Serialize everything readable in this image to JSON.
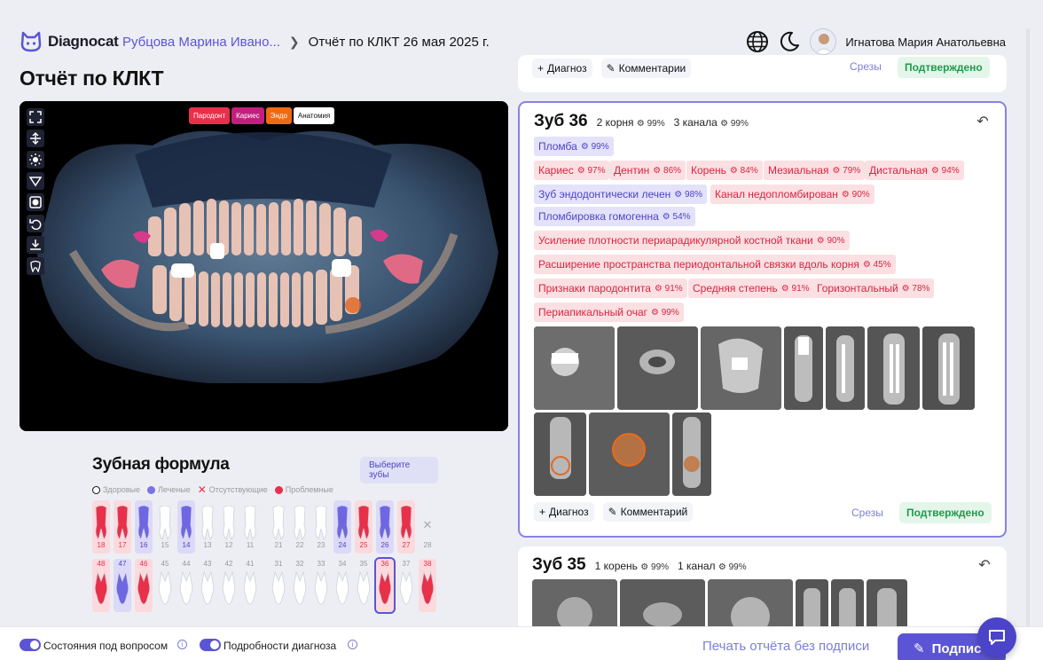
{
  "app": {
    "name": "Diagnocat"
  },
  "breadcrumb": {
    "patient": "Рубцова Марина Ивано...",
    "report": "Отчёт по КЛКТ 26 мая 2025 г."
  },
  "user": {
    "name": "Игнатова Мария Анатольевна"
  },
  "page": {
    "title": "Отчёт по КЛКТ"
  },
  "viewer": {
    "tabs": [
      "Пародонт",
      "Кариес",
      "Эндо",
      "Анатомия"
    ]
  },
  "top_card": {
    "diagnosis_label": "Диагноз",
    "comment_label": "Комментарии",
    "slices_label": "Срезы",
    "status": "Подтверждено"
  },
  "tooth36": {
    "title": "Зуб 36",
    "roots": "2 корня",
    "roots_pct": "99%",
    "canals": "3 канала",
    "canals_pct": "99%",
    "tags": [
      {
        "label": "Пломба",
        "pct": "99%"
      },
      {
        "label": "Кариес",
        "pct": "97%"
      },
      {
        "label": "Дентин",
        "pct": "86%"
      },
      {
        "label": "Корень",
        "pct": "84%"
      },
      {
        "label": "Мезиальная",
        "pct": "79%"
      },
      {
        "label": "Дистальная",
        "pct": "94%"
      },
      {
        "label": "Зуб эндодонтически лечен",
        "pct": "98%"
      },
      {
        "label": "Канал недопломбирован",
        "pct": "90%"
      },
      {
        "label": "Пломбировка гомогенна",
        "pct": "54%"
      },
      {
        "label": "Усиление плотности периарадикулярной костной ткани",
        "pct": "90%"
      },
      {
        "label": "Расширение пространства периодонтальной связки вдоль корня",
        "pct": "45%"
      },
      {
        "label": "Признаки пародонтита",
        "pct": "91%"
      },
      {
        "label": "Средняя степень",
        "pct": "91%"
      },
      {
        "label": "Горизонтальный",
        "pct": "78%"
      },
      {
        "label": "Периапикальный очаг",
        "pct": "99%"
      }
    ],
    "diagnosis_label": "Диагноз",
    "comment_label": "Комментарий",
    "slices_label": "Срезы",
    "status": "Подтверждено"
  },
  "tooth35": {
    "title": "Зуб 35",
    "roots": "1 корень",
    "roots_pct": "99%",
    "canals": "1 канал",
    "canals_pct": "99%"
  },
  "formula": {
    "title": "Зубная формула",
    "select_button": "Выберите зубы",
    "legend": [
      {
        "label": "Здоровые",
        "color": "#ffffff"
      },
      {
        "label": "Леченые",
        "color": "#7b72e8"
      },
      {
        "label": "Отсутствующие",
        "color": "#e8304a"
      },
      {
        "label": "Проблемные",
        "color": "#e8304a"
      }
    ],
    "upper": [
      {
        "n": "18",
        "s": "problem"
      },
      {
        "n": "17",
        "s": "problem"
      },
      {
        "n": "16",
        "s": "treated"
      },
      {
        "n": "15",
        "s": "healthy"
      },
      {
        "n": "14",
        "s": "treated"
      },
      {
        "n": "13",
        "s": "healthy"
      },
      {
        "n": "12",
        "s": "healthy"
      },
      {
        "n": "11",
        "s": "healthy"
      },
      {
        "n": "21",
        "s": "healthy"
      },
      {
        "n": "22",
        "s": "healthy"
      },
      {
        "n": "23",
        "s": "healthy"
      },
      {
        "n": "24",
        "s": "treated"
      },
      {
        "n": "25",
        "s": "problem"
      },
      {
        "n": "26",
        "s": "treated"
      },
      {
        "n": "27",
        "s": "problem"
      },
      {
        "n": "28",
        "s": "missing"
      }
    ],
    "lower": [
      {
        "n": "48",
        "s": "problem"
      },
      {
        "n": "47",
        "s": "treated"
      },
      {
        "n": "46",
        "s": "problem"
      },
      {
        "n": "45",
        "s": "healthy"
      },
      {
        "n": "44",
        "s": "healthy"
      },
      {
        "n": "43",
        "s": "healthy"
      },
      {
        "n": "42",
        "s": "healthy"
      },
      {
        "n": "41",
        "s": "healthy"
      },
      {
        "n": "31",
        "s": "healthy"
      },
      {
        "n": "32",
        "s": "healthy"
      },
      {
        "n": "33",
        "s": "healthy"
      },
      {
        "n": "34",
        "s": "healthy"
      },
      {
        "n": "35",
        "s": "healthy"
      },
      {
        "n": "36",
        "s": "problem"
      },
      {
        "n": "37",
        "s": "healthy"
      },
      {
        "n": "38",
        "s": "problem"
      }
    ],
    "selected": "36"
  },
  "bottom": {
    "toggle1": "Состояния под вопросом",
    "toggle2": "Подробности диагноза",
    "print": "Печать отчёта без подписи",
    "sign": "Подпис"
  },
  "colors": {
    "accent": "#5b55d6",
    "problem": "#e8304a",
    "treated": "#7b72e8",
    "confirmed": "#1e9b4b"
  }
}
